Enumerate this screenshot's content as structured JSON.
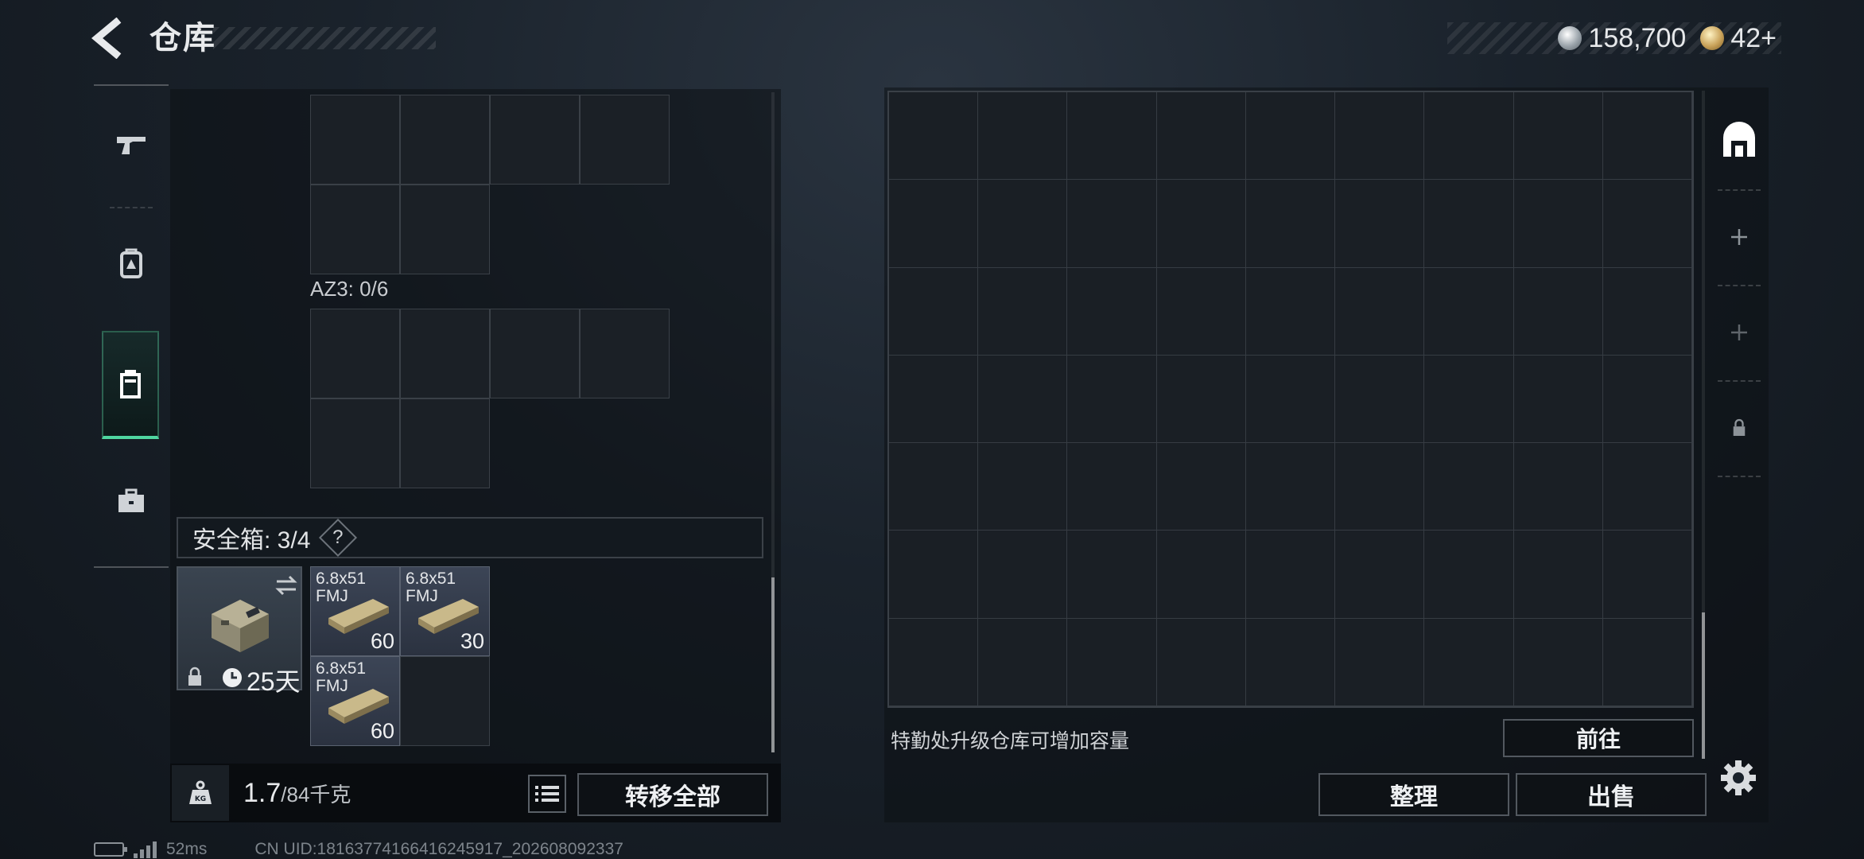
{
  "header": {
    "title": "仓库",
    "currencies": [
      {
        "icon": "silver-coin-icon",
        "value": "158,700"
      },
      {
        "icon": "gold-coin-icon",
        "value": "42+"
      }
    ]
  },
  "left_tabs": [
    {
      "icon": "pistol-icon"
    },
    {
      "icon": "backpack-icon"
    },
    {
      "icon": "secure-container-icon",
      "selected": true
    },
    {
      "icon": "briefcase-icon"
    }
  ],
  "left_panel": {
    "az3_label": "AZ3: 0/6",
    "safe_box": {
      "label": "安全箱: 3/4",
      "help": "?",
      "days_left": "25天"
    },
    "ammo_items": [
      {
        "name": "6.8x51\nFMJ",
        "count": "60"
      },
      {
        "name": "6.8x51\nFMJ",
        "count": "30"
      },
      {
        "name": "6.8x51\nFMJ",
        "count": "60"
      }
    ],
    "weight": {
      "current": "1.7",
      "max": "/84千克"
    },
    "transfer_all": "转移全部"
  },
  "right_panel": {
    "grid": {
      "columns": 9,
      "rows": 7
    },
    "upgrade_hint": "特勤处升级仓库可增加容量",
    "goto": "前往",
    "organize": "整理",
    "sell": "出售"
  },
  "status_bar": {
    "ping": "52ms",
    "uid": "CN UID:18163774166416245917_202608092337"
  },
  "colors": {
    "accent_green": "#4fd6a0",
    "panel_bg": "#1b2026",
    "grid_line": "#3a4047"
  }
}
